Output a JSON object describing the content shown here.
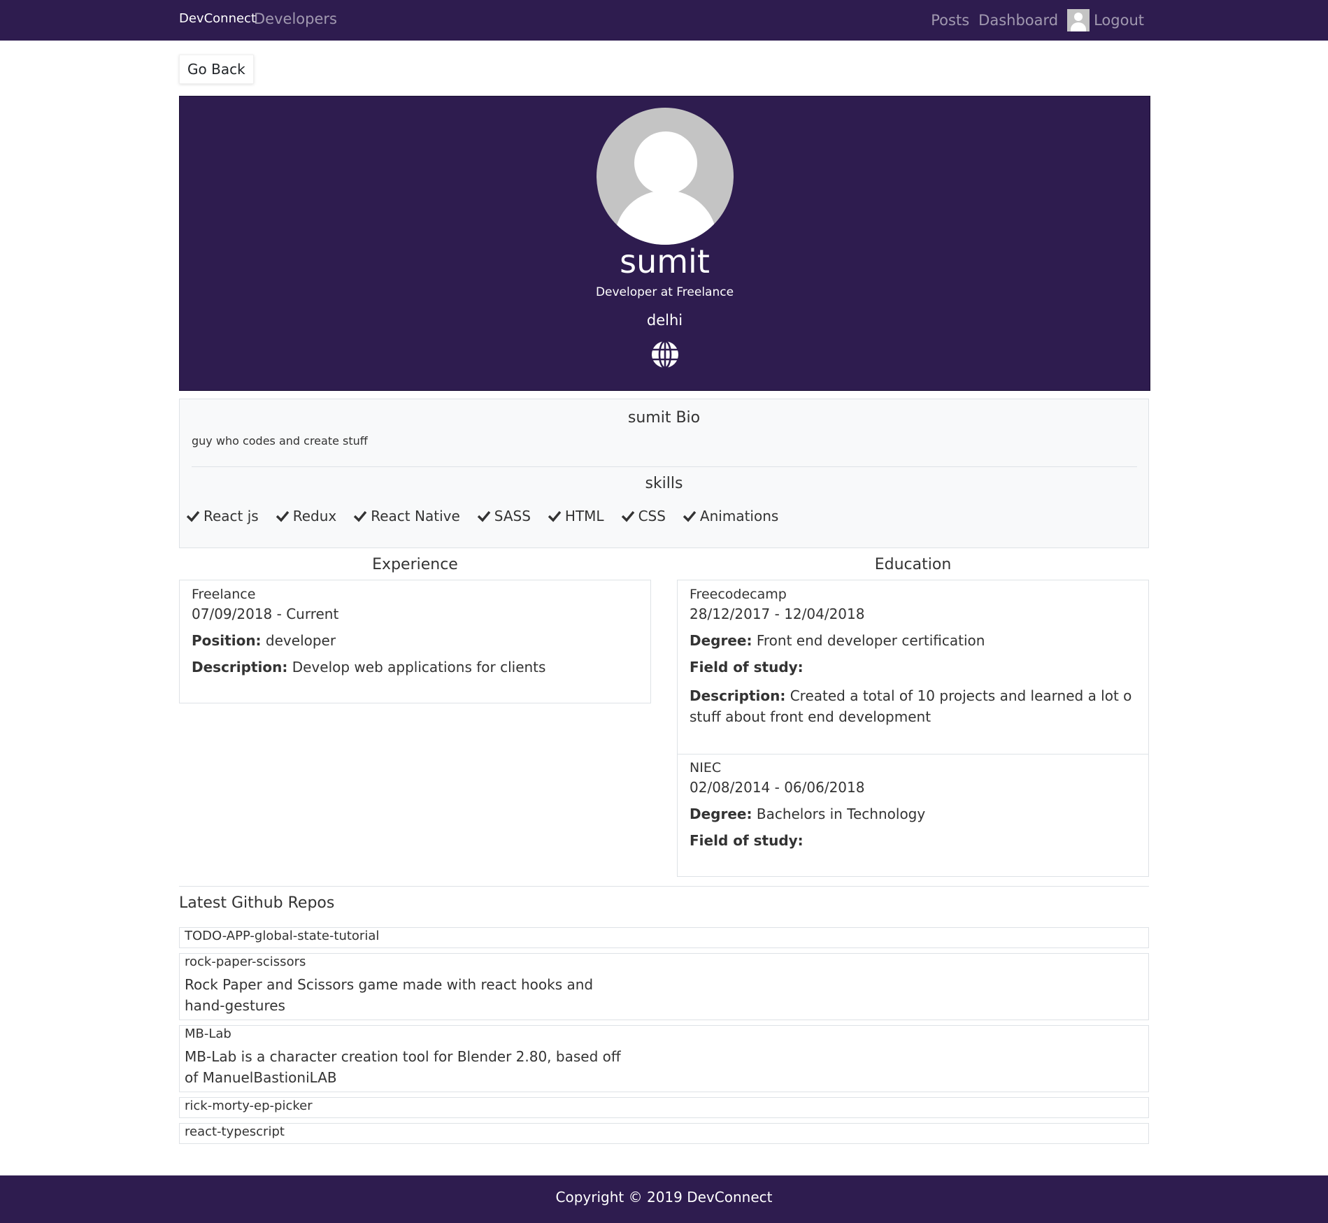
{
  "navbar": {
    "brand": "DevConnect",
    "developers": "Developers",
    "posts": "Posts",
    "dashboard": "Dashboard",
    "logout": "Logout"
  },
  "go_back": "Go Back",
  "profile": {
    "name": "sumit",
    "status": "Developer at Freelance",
    "location": "delhi",
    "website_icon": "globe-icon"
  },
  "about": {
    "bio_title": "sumit Bio",
    "bio": "guy who codes and create stuff",
    "skills_title": "skills",
    "skills": [
      "React js",
      "Redux",
      "React Native",
      "SASS",
      "HTML",
      "CSS",
      "Animations"
    ]
  },
  "experience": {
    "title": "Experience",
    "items": [
      {
        "company": "Freelance",
        "dates": "07/09/2018 - Current",
        "position_label": "Position:",
        "position": "developer",
        "description_label": "Description:",
        "description": "Develop web applications for clients"
      }
    ]
  },
  "education": {
    "title": "Education",
    "items": [
      {
        "school": "Freecodecamp",
        "dates": "28/12/2017 - 12/04/2018",
        "degree_label": "Degree:",
        "degree": "Front end developer certification",
        "field_label": "Field of study:",
        "description_label": "Description:",
        "description": "Created a total of 10 projects and learned a lot o stuff about front end development"
      },
      {
        "school": "NIEC",
        "dates": "02/08/2014 - 06/06/2018",
        "degree_label": "Degree:",
        "degree": "Bachelors in Technology",
        "field_label": "Field of study:"
      }
    ]
  },
  "repos": {
    "title": "Latest Github Repos",
    "items": [
      {
        "name": "TODO-APP-global-state-tutorial",
        "description": ""
      },
      {
        "name": "rock-paper-scissors",
        "description": "Rock Paper and Scissors game made with react hooks and hand-gestures"
      },
      {
        "name": "MB-Lab",
        "description": "MB-Lab is a character creation tool for Blender 2.80, based off of ManuelBastioniLAB"
      },
      {
        "name": "rick-morty-ep-picker",
        "description": ""
      },
      {
        "name": "react-typescript",
        "description": ""
      }
    ]
  },
  "footer": {
    "text": "Copyright © 2019 DevConnect"
  },
  "colors": {
    "brand_purple": "#2e1c4f",
    "about_bg": "#f8f9fa"
  }
}
